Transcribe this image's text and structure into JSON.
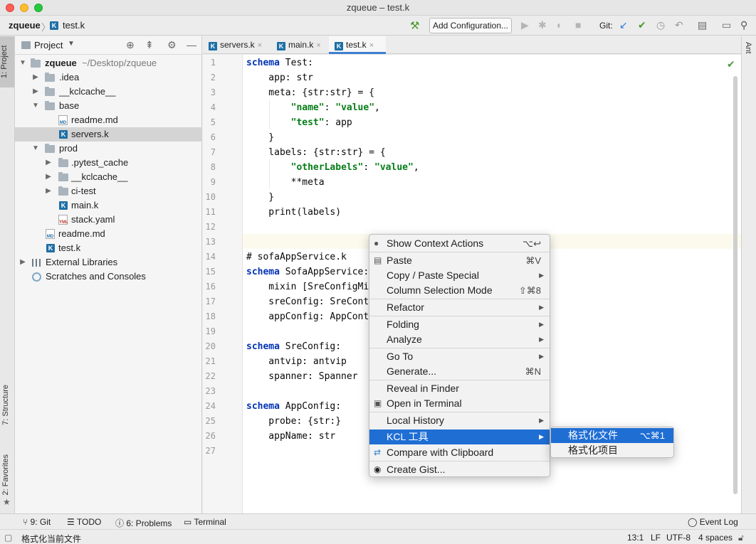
{
  "window": {
    "title": "zqueue – test.k"
  },
  "navbar": {
    "project": "zqueue",
    "file": "test.k",
    "add_configuration": "Add Configuration...",
    "git_label": "Git:"
  },
  "left_strip": {
    "project_tab": "1: Project",
    "structure_tab": "7: Structure",
    "favorites_tab": "2: Favorites"
  },
  "right_strip": {
    "ant_tab": "Ant"
  },
  "project_panel": {
    "title": "Project",
    "tree": [
      {
        "label": "zqueue",
        "hint": "~/Desktop/zqueue"
      },
      {
        "label": ".idea"
      },
      {
        "label": "__kclcache__"
      },
      {
        "label": "base"
      },
      {
        "label": "readme.md"
      },
      {
        "label": "servers.k"
      },
      {
        "label": "prod"
      },
      {
        "label": ".pytest_cache"
      },
      {
        "label": "__kclcache__"
      },
      {
        "label": "ci-test"
      },
      {
        "label": "main.k"
      },
      {
        "label": "stack.yaml"
      },
      {
        "label": "readme.md"
      },
      {
        "label": "test.k"
      },
      {
        "label": "External Libraries"
      },
      {
        "label": "Scratches and Consoles"
      }
    ]
  },
  "editor_tabs": [
    {
      "label": "servers.k"
    },
    {
      "label": "main.k"
    },
    {
      "label": "test.k"
    }
  ],
  "editor": {
    "line_numbers": [
      "1",
      "2",
      "3",
      "4",
      "5",
      "6",
      "7",
      "8",
      "9",
      "10",
      "11",
      "12",
      "13",
      "14",
      "15",
      "16",
      "17",
      "18",
      "19",
      "20",
      "21",
      "22",
      "23",
      "24",
      "25",
      "26",
      "27"
    ],
    "lines": [
      "schema Test:",
      "    app: str",
      "    meta: {str:str} = {",
      "        \"name\": \"value\",",
      "        \"test\": app",
      "    }",
      "    labels: {str:str} = {",
      "        \"otherLabels\": \"value\",",
      "        **meta",
      "    }",
      "    print(labels)",
      "",
      "",
      "# sofaAppService.k",
      "schema SofaAppService:",
      "    mixin [SreConfigMi",
      "    sreConfig: SreCont",
      "    appConfig: AppCont",
      "",
      "schema SreConfig:",
      "    antvip: antvip",
      "    spanner: Spanner",
      "",
      "schema AppConfig:",
      "    probe: {str:}",
      "    appName: str",
      ""
    ]
  },
  "context_menu": {
    "items": [
      {
        "label": "Show Context Actions",
        "shortcut": "⌥↩"
      },
      {
        "label": "Paste",
        "shortcut": "⌘V"
      },
      {
        "label": "Copy / Paste Special"
      },
      {
        "label": "Column Selection Mode",
        "shortcut": "⇧⌘8"
      },
      {
        "label": "Refactor"
      },
      {
        "label": "Folding"
      },
      {
        "label": "Analyze"
      },
      {
        "label": "Go To"
      },
      {
        "label": "Generate...",
        "shortcut": "⌘N"
      },
      {
        "label": "Reveal in Finder"
      },
      {
        "label": "Open in Terminal"
      },
      {
        "label": "Local History"
      },
      {
        "label": "KCL 工具"
      },
      {
        "label": "Compare with Clipboard"
      },
      {
        "label": "Create Gist..."
      }
    ]
  },
  "submenu": {
    "items": [
      {
        "label": "格式化文件",
        "shortcut": "⌥⌘1"
      },
      {
        "label": "格式化项目"
      }
    ]
  },
  "bottom_tools": {
    "git": "9: Git",
    "todo": "TODO",
    "problems": "6: Problems",
    "terminal": "Terminal",
    "event_log": "Event Log"
  },
  "status_bar": {
    "message": "格式化当前文件",
    "position": "13:1",
    "line_sep": "LF",
    "encoding": "UTF-8",
    "indent": "4 spaces"
  }
}
